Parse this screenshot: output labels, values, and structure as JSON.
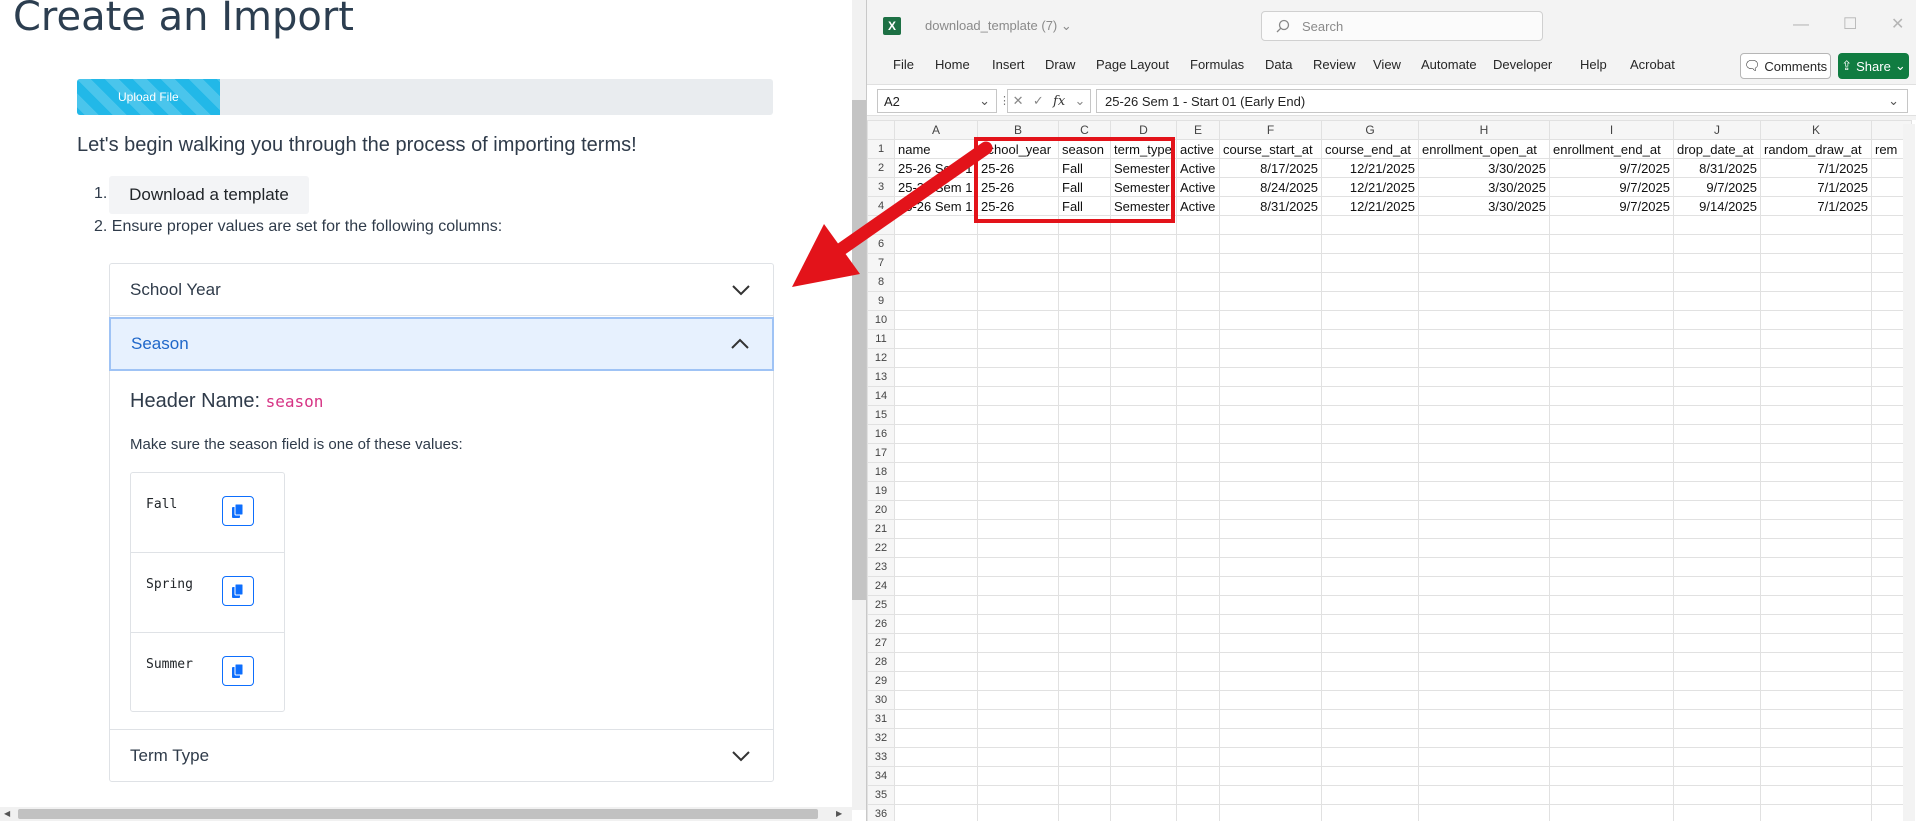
{
  "left": {
    "title": "Create an Import",
    "progress": {
      "label": "Upload File",
      "fraction": 0.205
    },
    "intro": "Let's begin walking you through the process of importing terms!",
    "step1_num": "1.",
    "download_label": "Download a template",
    "step2": "2. Ensure proper values are set for the following columns:",
    "accordion": {
      "school_year": "School Year",
      "season": "Season",
      "term_type": "Term Type",
      "header_prefix": "Header Name:",
      "header_code": "season",
      "make_sure": "Make sure the season field is one of these values:",
      "values": [
        "Fall",
        "Spring",
        "Summer"
      ]
    }
  },
  "excel": {
    "doc_name": "download_template (7)",
    "search_placeholder": "Search",
    "menu": [
      "File",
      "Home",
      "Insert",
      "Draw",
      "Page Layout",
      "Formulas",
      "Data",
      "Review",
      "View",
      "Automate",
      "Developer",
      "Help",
      "Acrobat"
    ],
    "comments_label": "Comments",
    "share_label": "Share",
    "name_box": "A2",
    "formula_value": "25-26 Sem 1 - Start 01 (Early End)",
    "columns": [
      "A",
      "B",
      "C",
      "D",
      "E",
      "F",
      "G",
      "H",
      "I",
      "J",
      "K",
      ""
    ],
    "header_row": [
      "name",
      "school_year",
      "season",
      "term_type",
      "active",
      "course_start_at",
      "course_end_at",
      "enrollment_open_at",
      "enrollment_end_at",
      "drop_date_at",
      "random_draw_at",
      "rem"
    ],
    "rows": [
      [
        "25-26 Sem 1",
        "25-26",
        "Fall",
        "Semester",
        "Active",
        "8/17/2025",
        "12/21/2025",
        "3/30/2025",
        "9/7/2025",
        "8/31/2025",
        "7/1/2025",
        ""
      ],
      [
        "25-26 Sem 1",
        "25-26",
        "Fall",
        "Semester",
        "Active",
        "8/24/2025",
        "12/21/2025",
        "3/30/2025",
        "9/7/2025",
        "9/7/2025",
        "7/1/2025",
        ""
      ],
      [
        "25-26 Sem 1",
        "25-26",
        "Fall",
        "Semester",
        "Active",
        "8/31/2025",
        "12/21/2025",
        "3/30/2025",
        "9/7/2025",
        "9/14/2025",
        "7/1/2025",
        ""
      ]
    ],
    "row_count": 36
  },
  "colors": {
    "accent": "#22b8e8",
    "season_active": "#1f67c9",
    "code": "#d63384",
    "excel_green": "#107c41",
    "highlight_red": "#e3131a"
  }
}
